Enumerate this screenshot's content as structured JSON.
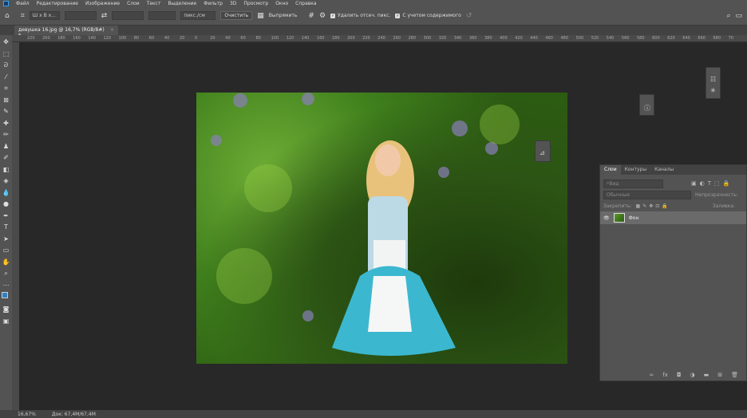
{
  "menu": [
    "Файл",
    "Редактирование",
    "Изображение",
    "Слои",
    "Текст",
    "Выделение",
    "Фильтр",
    "3D",
    "Просмотр",
    "Окно",
    "Справка"
  ],
  "options": {
    "ratio": "Ш х В х...",
    "units": "пикс./см",
    "clear": "Очистить",
    "straighten": "Выпрямить",
    "delete_cropped": "Удалить отсеч. пикс.",
    "content_aware": "С учетом содержимого"
  },
  "document": {
    "tab": "девушка 16.jpg @ 16,7% (RGB/8#) *",
    "close": "×"
  },
  "ruler": [
    "220",
    "200",
    "180",
    "160",
    "140",
    "120",
    "100",
    "80",
    "60",
    "40",
    "20",
    "0",
    "20",
    "40",
    "60",
    "80",
    "100",
    "120",
    "140",
    "160",
    "180",
    "200",
    "220",
    "240",
    "260",
    "280",
    "300",
    "320",
    "340",
    "360",
    "380",
    "400",
    "420",
    "440",
    "460",
    "480",
    "500",
    "520",
    "540",
    "560",
    "580",
    "600",
    "620",
    "640",
    "660",
    "680",
    "70"
  ],
  "layers": {
    "tabs": [
      "Слои",
      "Контуры",
      "Каналы"
    ],
    "filter": "Вид",
    "blend": "Обычные",
    "opacity_label": "Непрозрачность:",
    "lock_label": "Закрепить:",
    "fill_label": "Заливка:",
    "layer_name": "Фон"
  },
  "status": {
    "zoom": "16,67%",
    "doc": "Док: 67,4M/67,4M"
  },
  "colors": {
    "fg": "#2f7fc4",
    "bg": "#ffffff"
  }
}
